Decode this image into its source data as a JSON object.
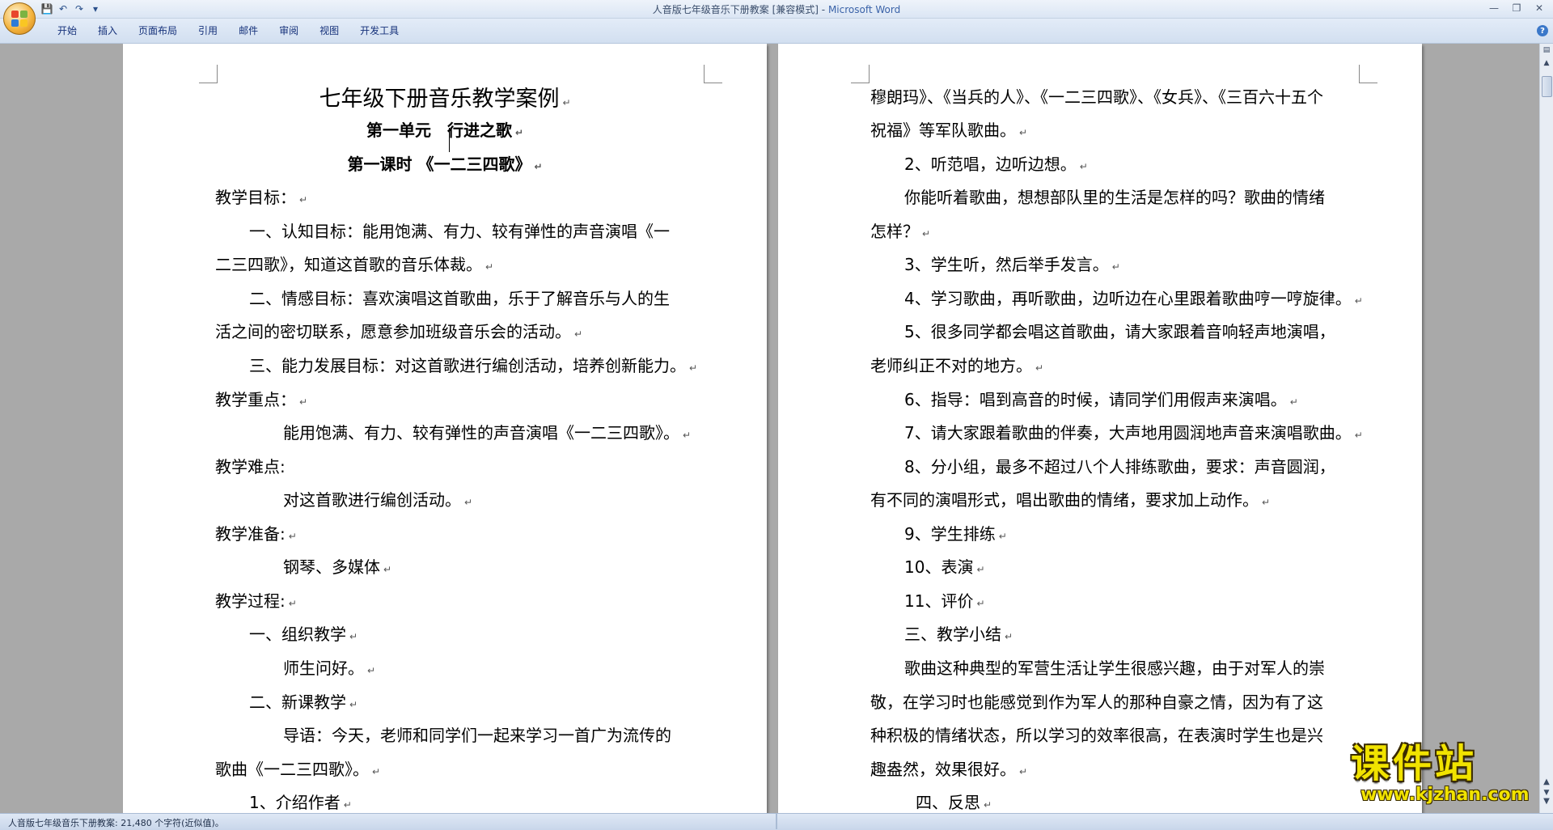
{
  "window": {
    "title": "人音版七年级音乐下册教案 [兼容模式]",
    "app_name": "Microsoft Word",
    "title_separator": " - "
  },
  "quick_access": {
    "save_icon": "save-icon",
    "undo_icon": "undo-icon",
    "redo_icon": "redo-icon",
    "customize_icon": "chevron-down-icon"
  },
  "ribbon": {
    "tabs": [
      "开始",
      "插入",
      "页面布局",
      "引用",
      "邮件",
      "审阅",
      "视图",
      "开发工具"
    ]
  },
  "pages": {
    "left": {
      "title": "七年级下册音乐教学案例",
      "unit": "第一单元　行进之歌",
      "lesson": "第一课时 《一二三四歌》",
      "lines": [
        "教学目标：",
        "一、认知目标：能用饱满、有力、较有弹性的声音演唱《一",
        "二三四歌》，知道这首歌的音乐体裁。",
        "二、情感目标：喜欢演唱这首歌曲，乐于了解音乐与人的生",
        "活之间的密切联系，愿意参加班级音乐会的活动。",
        "三、能力发展目标：对这首歌进行编创活动，培养创新能力。",
        "教学重点：",
        "能用饱满、有力、较有弹性的声音演唱《一二三四歌》。",
        "教学难点:",
        "对这首歌进行编创活动。",
        "教学准备:",
        "钢琴、多媒体",
        "教学过程:",
        "一、组织教学",
        "师生问好。",
        "二、新课教学",
        "导语：今天，老师和同学们一起来学习一首广为流传的",
        "歌曲《一二三四歌》。",
        "1、介绍作者"
      ]
    },
    "right": {
      "lines": [
        "穆朗玛》、《当兵的人》、《一二三四歌》、《女兵》、《三百六十五个",
        "祝福》等军队歌曲。",
        "2、听范唱，边听边想。",
        "你能听着歌曲，想想部队里的生活是怎样的吗？歌曲的情绪",
        "怎样？",
        "3、学生听，然后举手发言。",
        "4、学习歌曲，再听歌曲，边听边在心里跟着歌曲哼一哼旋律。",
        "5、很多同学都会唱这首歌曲，请大家跟着音响轻声地演唱，",
        "老师纠正不对的地方。",
        "6、指导：唱到高音的时候，请同学们用假声来演唱。",
        "7、请大家跟着歌曲的伴奏，大声地用圆润地声音来演唱歌曲。",
        "8、分小组，最多不超过八个人排练歌曲，要求：声音圆润，",
        "有不同的演唱形式，唱出歌曲的情绪，要求加上动作。",
        "9、学生排练",
        "10、表演",
        "11、评价",
        "三、教学小结",
        "歌曲这种典型的军营生活让学生很感兴趣，由于对军人的崇",
        "敬，在学习时也能感觉到作为军人的那种自豪之情，因为有了这",
        "种积极的情绪状态，所以学习的效率很高，在表演时学生也是兴",
        "趣盎然，效果很好。",
        "四、反思"
      ]
    },
    "paragraph_mark": "↵"
  },
  "status_bar": {
    "text": "人音版七年级音乐下册教案: 21,480 个字符(近似值)。"
  },
  "watermark": {
    "title": "课件站",
    "url": "www.kjzhan.com"
  }
}
